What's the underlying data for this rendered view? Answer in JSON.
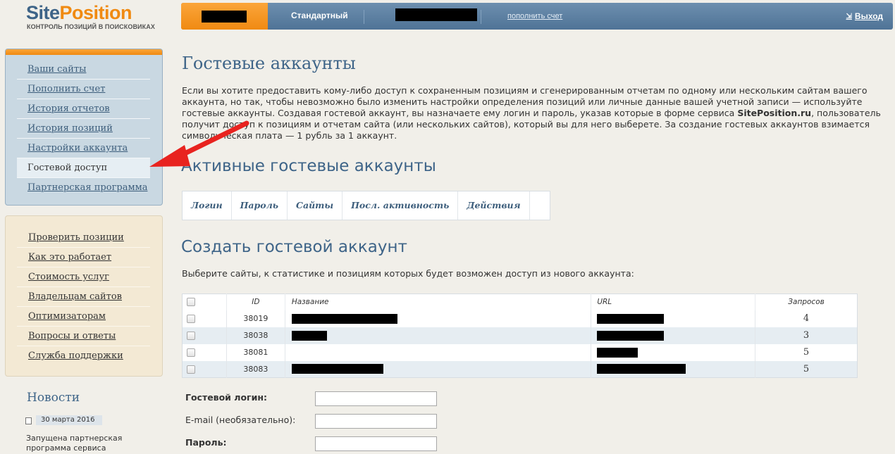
{
  "logo": {
    "part1": "Site",
    "part2": "Position",
    "tagline": "КОНТРОЛЬ ПОЗИЦИЙ В ПОИСКОВИКАХ"
  },
  "topbar": {
    "tariff": "Стандартный",
    "topup": "пополнить счет",
    "logout": "Выход",
    "logout_icon": "logout-icon"
  },
  "menu_main": [
    {
      "label": "Ваши сайты"
    },
    {
      "label": "Пополнить счет"
    },
    {
      "label": "История отчетов"
    },
    {
      "label": "История позиций"
    },
    {
      "label": "Настройки аккаунта"
    },
    {
      "label": "Гостевой доступ",
      "active": true
    },
    {
      "label": "Партнерская программа"
    }
  ],
  "menu_info": [
    {
      "label": "Проверить позиции"
    },
    {
      "label": "Как это работает"
    },
    {
      "label": "Стоимость услуг"
    },
    {
      "label": "Владельцам сайтов"
    },
    {
      "label": "Оптимизаторам"
    },
    {
      "label": "Вопросы и ответы"
    },
    {
      "label": "Служба поддержки"
    }
  ],
  "news": {
    "title": "Новости",
    "date": "30 марта 2016",
    "text": "Запущена партнерская программа сервиса SitePosition.ru!"
  },
  "page": {
    "title": "Гостевые аккаунты",
    "intro_before": "Если вы хотите предоставить кому-либо доступ к сохраненным позициям и сгенерированным отчетам по одному или нескольким сайтам вашего аккаунта, но так, чтобы невозможно было изменить настройки определения позиций или личные данные вашей учетной записи — используйте гостевые аккаунты. Создавая гостевой аккаунт, вы назначаете ему логин и пароль, указав которые в форме сервиса ",
    "intro_brand": "SitePosition.ru",
    "intro_after": ", пользователь получит доступ к позициям и отчетам сайта (или нескольких сайтов), который вы для него выберете. За создание гостевых аккаунтов взимается символическая плата — 1 рубль за 1 аккаунт.",
    "active_title": "Активные гостевые аккаунты",
    "active_columns": [
      "Логин",
      "Пароль",
      "Сайты",
      "Посл. активность",
      "Действия"
    ],
    "create_title": "Создать гостевой аккаунт",
    "sites_hint": "Выберите сайты, к статистике и позициям которых будет возможен доступ из нового аккаунта:",
    "sites_columns": {
      "id": "ID",
      "name": "Название",
      "url": "URL",
      "requests": "Запросов"
    },
    "sites": [
      {
        "id": "38019",
        "requests": "4"
      },
      {
        "id": "38038",
        "requests": "3"
      },
      {
        "id": "38081",
        "requests": "5"
      },
      {
        "id": "38083",
        "requests": "5"
      }
    ],
    "form": {
      "login_label": "Гостевой логин:",
      "email_label": "E-mail (необязательно):",
      "password_label": "Пароль:"
    }
  },
  "colors": {
    "accent": "#f08a12",
    "brand_blue": "#3e6488",
    "annotation_arrow": "#e8231f"
  }
}
